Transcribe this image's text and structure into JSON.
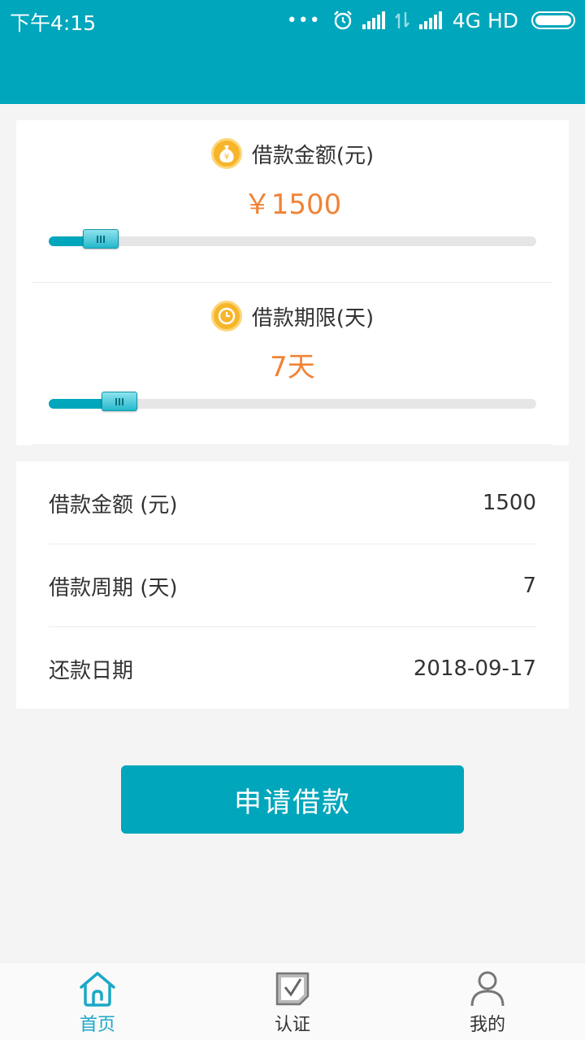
{
  "status_bar": {
    "time": "下午4:15",
    "dots": "•••",
    "network": "4G HD"
  },
  "colors": {
    "primary": "#00a6bb",
    "accent_value": "#f08336",
    "coin_icon": "#f7b52c",
    "nav_active": "#1aa8c6"
  },
  "sliders": {
    "amount": {
      "label": "借款金额(元)",
      "value": "￥1500",
      "icon": "money-bag-icon",
      "fraction": 0.107
    },
    "term": {
      "label": "借款期限(天)",
      "value": "7天",
      "icon": "clock-icon",
      "fraction": 0.145
    }
  },
  "summary": {
    "rows": [
      {
        "label": "借款金额 (元)",
        "value": "1500"
      },
      {
        "label": "借款周期 (天)",
        "value": "7"
      },
      {
        "label": "还款日期",
        "value": "2018-09-17"
      }
    ]
  },
  "apply_button": "申请借款",
  "bottom_nav": {
    "items": [
      {
        "label": "首页",
        "icon": "home-icon",
        "active": true
      },
      {
        "label": "认证",
        "icon": "checkbox-icon",
        "active": false
      },
      {
        "label": "我的",
        "icon": "user-icon",
        "active": false
      }
    ]
  }
}
